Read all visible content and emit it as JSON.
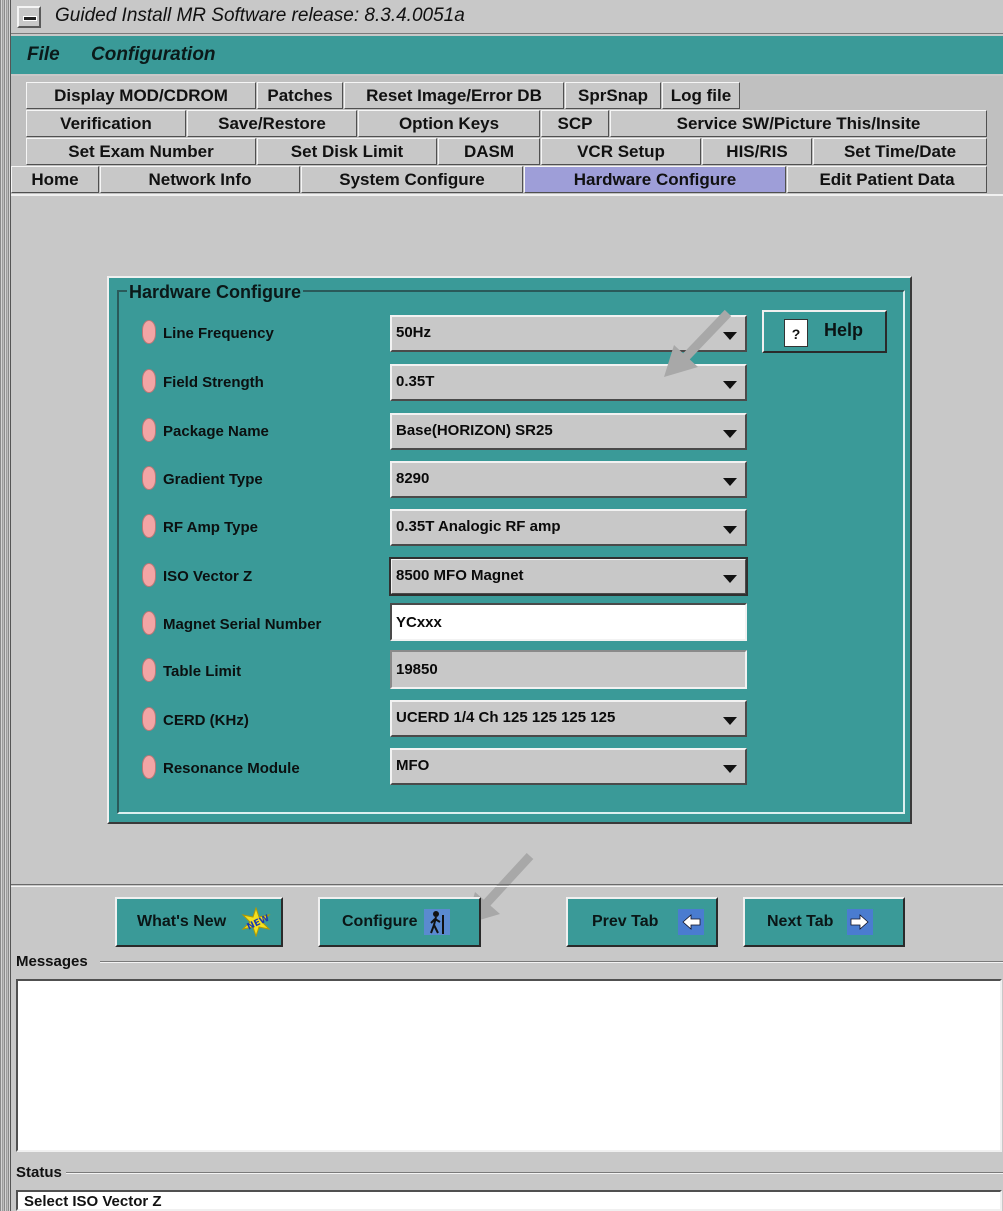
{
  "window": {
    "title": "Guided Install  MR Software release: 8.3.4.0051a"
  },
  "menubar": {
    "items": [
      "File",
      "Configuration"
    ]
  },
  "tabs": {
    "row1": [
      "Display MOD/CDROM",
      "Patches",
      "Reset Image/Error DB",
      "SprSnap",
      "Log file"
    ],
    "row2": [
      "Verification",
      "Save/Restore",
      "Option Keys",
      "SCP",
      "Service SW/Picture This/Insite"
    ],
    "row3": [
      "Set Exam Number",
      "Set Disk Limit",
      "DASM",
      "VCR Setup",
      "HIS/RIS",
      "Set Time/Date"
    ],
    "row4": [
      "Home",
      "Network Info",
      "System Configure",
      "Hardware Configure",
      "Edit Patient Data"
    ],
    "active": "Hardware Configure"
  },
  "panel": {
    "title": "Hardware Configure",
    "help_label": "Help",
    "rows": [
      {
        "label": "Line Frequency",
        "value": "50Hz",
        "kind": "select"
      },
      {
        "label": "Field Strength",
        "value": "0.35T",
        "kind": "select"
      },
      {
        "label": "Package Name",
        "value": "Base(HORIZON) SR25",
        "kind": "select"
      },
      {
        "label": "Gradient Type",
        "value": "8290",
        "kind": "select"
      },
      {
        "label": "RF Amp Type",
        "value": "0.35T Analogic RF amp",
        "kind": "select"
      },
      {
        "label": "ISO Vector Z",
        "value": "8500 MFO Magnet",
        "kind": "select"
      },
      {
        "label": "Magnet Serial Number",
        "value": "YCxxx",
        "kind": "text"
      },
      {
        "label": "Table Limit",
        "value": "19850",
        "kind": "readonly"
      },
      {
        "label": "CERD (KHz)",
        "value": "UCERD 1/4 Ch 125  125  125  125",
        "kind": "select"
      },
      {
        "label": "Resonance Module",
        "value": "MFO",
        "kind": "select"
      }
    ]
  },
  "actions": {
    "whats_new": "What's New",
    "configure": "Configure",
    "prev_tab": "Prev Tab",
    "next_tab": "Next Tab"
  },
  "messages": {
    "label": "Messages"
  },
  "status": {
    "label": "Status",
    "text": "Select ISO Vector Z"
  },
  "colors": {
    "teal": "#3a9a98",
    "active_tab": "#9e9ed8",
    "led": "#f3a5a5"
  }
}
